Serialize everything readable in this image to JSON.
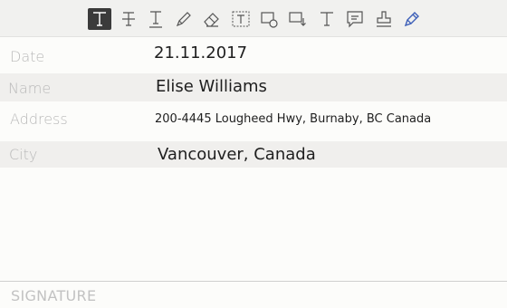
{
  "toolbar": {
    "tools": [
      {
        "icon": "text-tool-icon",
        "active": true
      },
      {
        "icon": "strikethrough-tool-icon",
        "active": false
      },
      {
        "icon": "underline-tool-icon",
        "active": false
      },
      {
        "icon": "pencil-tool-icon",
        "active": false
      },
      {
        "icon": "eraser-tool-icon",
        "active": false
      },
      {
        "icon": "textbox-tool-icon",
        "active": false
      },
      {
        "icon": "shape-comment-icon",
        "active": false
      },
      {
        "icon": "move-shape-icon",
        "active": false
      },
      {
        "icon": "plain-text-tool-icon",
        "active": false
      },
      {
        "icon": "comment-tool-icon",
        "active": false
      },
      {
        "icon": "stamp-tool-icon",
        "active": false
      },
      {
        "icon": "signature-pen-icon",
        "active": false
      }
    ],
    "active_color": "#3b3b3b",
    "accent_color": "#3d5fb8"
  },
  "form": {
    "date": {
      "label": "Date",
      "value": "21.11.2017"
    },
    "name": {
      "label": "Name",
      "value": "Elise Williams"
    },
    "address": {
      "label": "Address",
      "value": "200-4445 Lougheed Hwy, Burnaby, BC Canada"
    },
    "city": {
      "label": "City",
      "value": "Vancouver, Canada"
    }
  },
  "signature": {
    "label": "SIGNATURE"
  }
}
